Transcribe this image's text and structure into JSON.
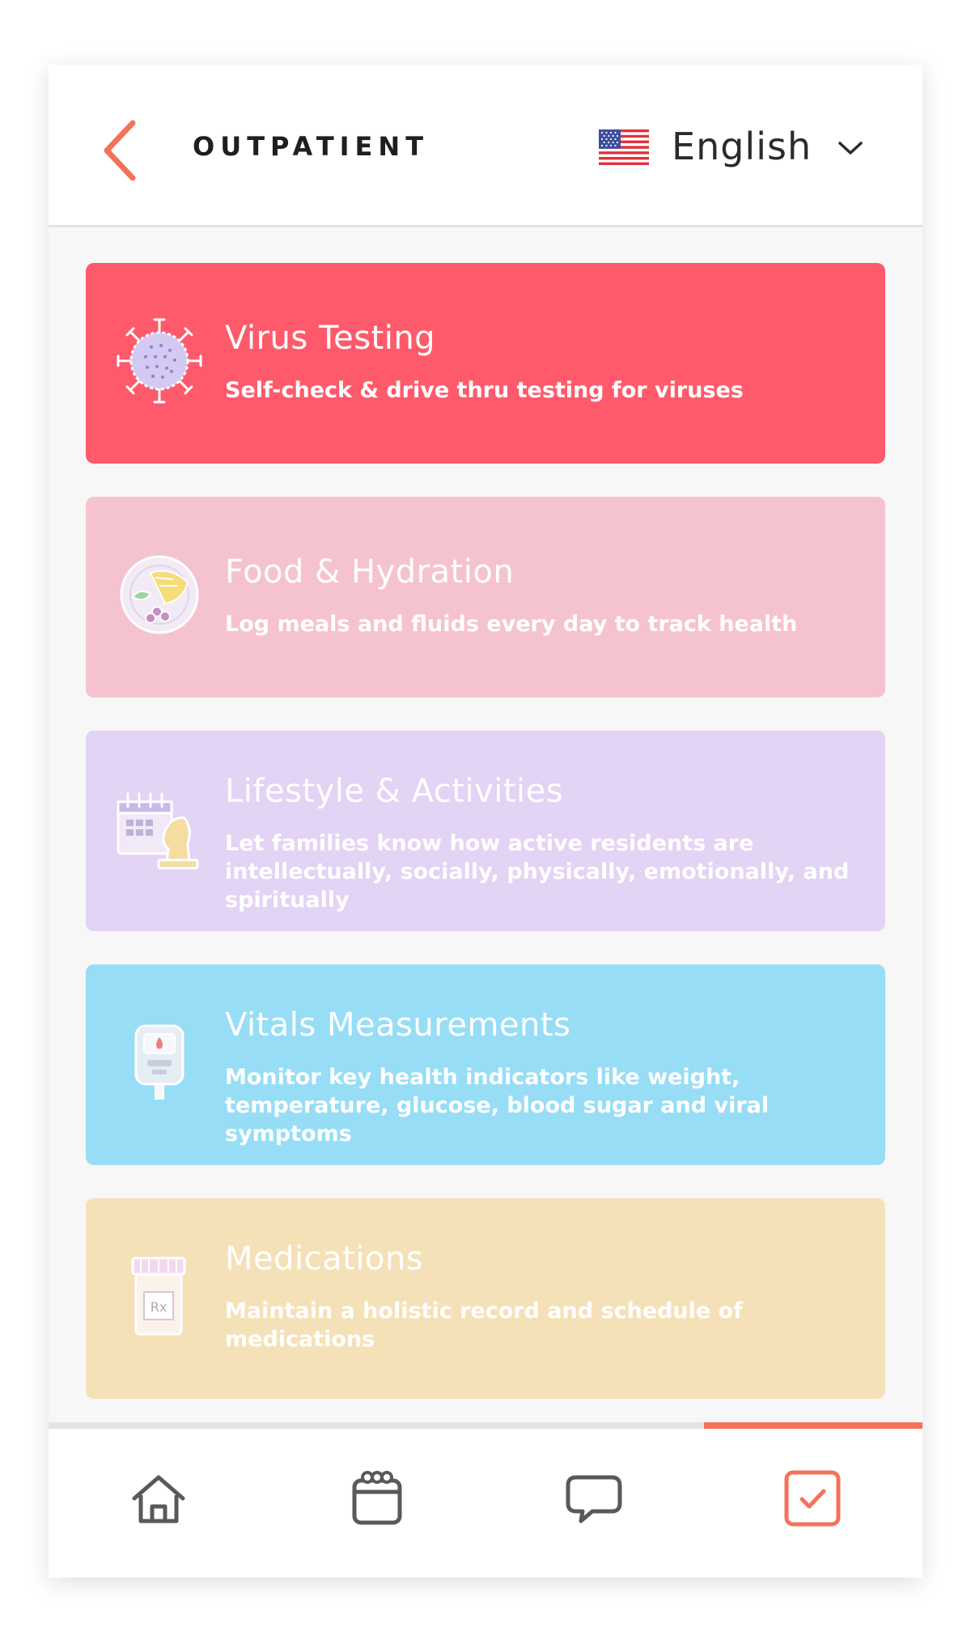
{
  "header": {
    "title": "OUTPATIENT",
    "language": "English",
    "back_icon": "chevron-left-icon",
    "flag_icon": "us-flag-icon",
    "dropdown_icon": "chevron-down-icon"
  },
  "colors": {
    "accent": "#f4725a",
    "virus_card": "#ff5a6b",
    "food_card": "#f5c3cf",
    "lifestyle_card": "#e3d3f4",
    "vitals_card": "#97ddf6",
    "medications_card": "#f5e1b8"
  },
  "cards": [
    {
      "title": "Virus Testing",
      "description": "Self-check & drive thru testing for viruses",
      "icon": "virus-icon"
    },
    {
      "title": "Food & Hydration",
      "description": "Log meals and fluids every day to track health",
      "icon": "food-plate-icon"
    },
    {
      "title": "Lifestyle & Activities",
      "description": "Let families know how active residents are intellectually, socially, physically, emotionally, and spiritually",
      "icon": "calendar-chess-icon"
    },
    {
      "title": "Vitals Measurements",
      "description": "Monitor key health indicators like weight, temperature, glucose, blood sugar and viral symptoms",
      "icon": "glucose-meter-icon"
    },
    {
      "title": "Medications",
      "description": "Maintain a holistic record and schedule of medications",
      "icon": "pill-bottle-icon"
    }
  ],
  "nav": {
    "items": [
      "home-icon",
      "calendar-icon",
      "chat-icon",
      "checklist-icon"
    ],
    "active_index": 3
  }
}
